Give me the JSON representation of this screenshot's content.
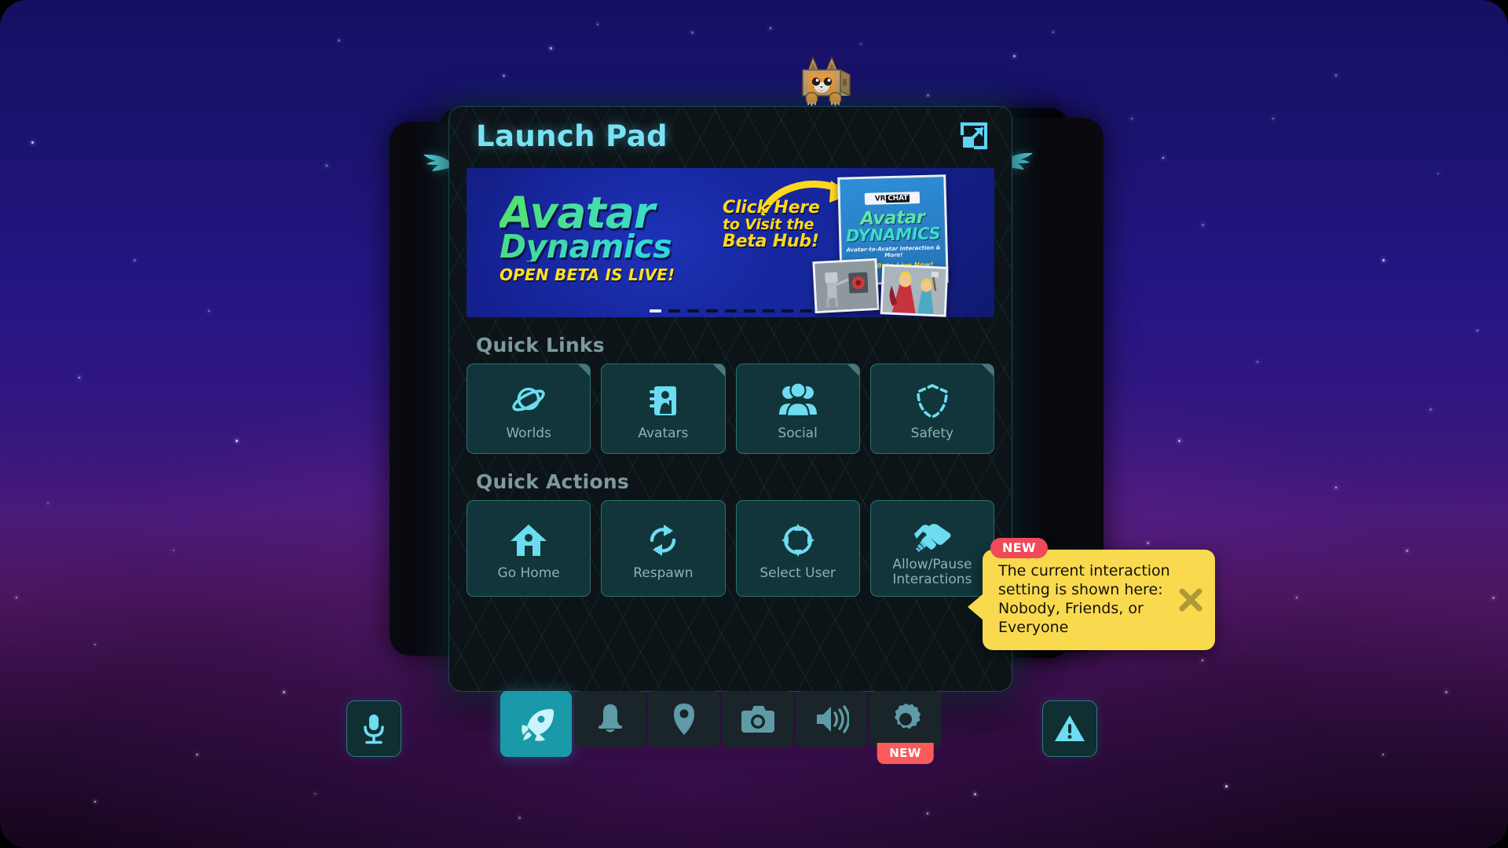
{
  "window": {
    "title": "Launch Pad",
    "expand_icon": "expand-icon"
  },
  "banner": {
    "title_line1": "Avatar",
    "title_line2": "Dynamics",
    "subtitle": "OPEN BETA IS LIVE!",
    "cta_line1": "Click Here",
    "cta_line2": "to Visit the",
    "cta_line3": "Beta Hub!",
    "poster": {
      "brand_vr": "VR",
      "brand_chat": "CHAT",
      "title_line1": "Avatar",
      "title_line2": "DYNAMICS",
      "tagline": "Avatar-to-Avatar Interaction & More!",
      "live_text": "Open Beta Live Now!"
    },
    "carousel": {
      "total_dots": 9,
      "active_index": 0
    }
  },
  "quick_links": {
    "heading": "Quick Links",
    "items": [
      {
        "label": "Worlds",
        "icon": "planet-icon"
      },
      {
        "label": "Avatars",
        "icon": "avatar-book-icon"
      },
      {
        "label": "Social",
        "icon": "people-icon"
      },
      {
        "label": "Safety",
        "icon": "shield-dashed-icon"
      }
    ]
  },
  "quick_actions": {
    "heading": "Quick Actions",
    "items": [
      {
        "label": "Go Home",
        "icon": "home-icon"
      },
      {
        "label": "Respawn",
        "icon": "refresh-icon"
      },
      {
        "label": "Select User",
        "icon": "target-icon"
      },
      {
        "label": "Allow/Pause\nInteractions",
        "label_line1": "Allow/Pause",
        "label_line2": "Interactions",
        "icon": "handshake-icon"
      }
    ]
  },
  "tooltip": {
    "badge": "NEW",
    "text": "The current interaction setting is shown here: Nobody, Friends, or Everyone",
    "close_icon": "close-icon"
  },
  "taskbar": {
    "mic_button": {
      "icon": "microphone-icon"
    },
    "warning_button": {
      "icon": "warning-triangle-icon"
    },
    "tabs": [
      {
        "name": "launch-pad",
        "icon": "rocket-icon",
        "active": true,
        "badge": ""
      },
      {
        "name": "notifications",
        "icon": "bell-icon",
        "active": false,
        "badge": ""
      },
      {
        "name": "location",
        "icon": "location-pin-icon",
        "active": false,
        "badge": ""
      },
      {
        "name": "camera",
        "icon": "camera-icon",
        "active": false,
        "badge": ""
      },
      {
        "name": "audio",
        "icon": "speaker-icon",
        "active": false,
        "badge": ""
      },
      {
        "name": "settings",
        "icon": "gear-icon",
        "active": false,
        "badge": "NEW"
      }
    ]
  },
  "colors": {
    "accent_cyan": "#79e2f2",
    "card_bg": "#11353a",
    "card_border": "#2e6f73",
    "tab_active": "#1a9aa8",
    "tooltip_bg": "#f9d94e",
    "badge_red": "#ef4a58",
    "banner_blue": "#16229a"
  },
  "mascot": {
    "name": "box-cat-mascot"
  }
}
